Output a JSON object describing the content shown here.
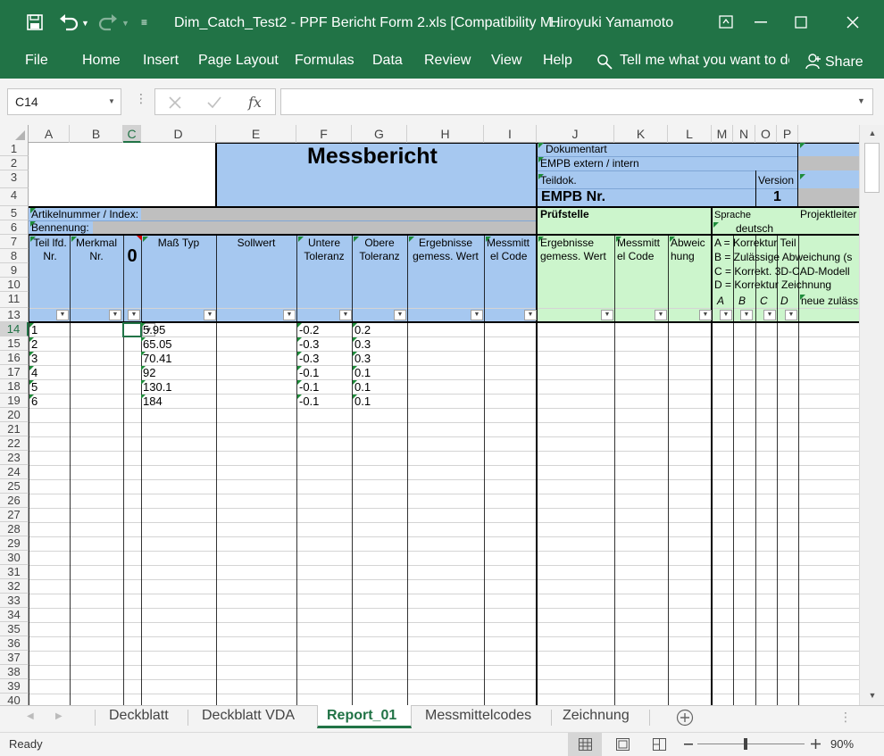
{
  "titlebar": {
    "title": "Dim_Catch_Test2 - PPF Bericht Form 2.xls  [Compatibility M...",
    "user": "Hiroyuki Yamamoto"
  },
  "menu": {
    "file": "File",
    "home": "Home",
    "insert": "Insert",
    "page_layout": "Page Layout",
    "formulas": "Formulas",
    "data": "Data",
    "review": "Review",
    "view": "View",
    "help": "Help",
    "tell_me": "Tell me what you want to do",
    "share": "Share"
  },
  "formula_bar": {
    "name_box": "C14",
    "fx": "fx",
    "content": ""
  },
  "columns": [
    "A",
    "B",
    "C",
    "D",
    "E",
    "F",
    "G",
    "H",
    "I",
    "J",
    "K",
    "L",
    "M",
    "N",
    "O",
    "P"
  ],
  "header": {
    "title": "Messbericht",
    "dokumentart": "Dokumentart",
    "empb_ext": "EMPB extern / intern",
    "teildok": "Teildok.",
    "empb_nr": "EMPB Nr.",
    "version": "Version",
    "version_val": "1",
    "artikel": "Artikelnummer / Index:",
    "benennung": "Bennenung:",
    "pruefstelle": "Prüfstelle",
    "sprache": "Sprache",
    "deutsch": "deutsch",
    "projektleiter": "Projektleiter"
  },
  "col_heads": {
    "teil_1": "Teil lfd.",
    "teil_2": "Nr.",
    "merkmal_1": "Merkmal",
    "merkmal_2": "Nr.",
    "c_glyph": "0",
    "mass": "Maß Typ",
    "sollwert": "Sollwert",
    "untere_1": "Untere",
    "untere_2": "Toleranz",
    "obere_1": "Obere",
    "obere_2": "Toleranz",
    "erg_h_1": "Ergebnisse",
    "erg_h_2": "gemess. Wert",
    "mess_i_1": "Messmitt",
    "mess_i_2": "el Code",
    "erg_j_1": "Ergebnisse",
    "erg_j_2": "gemess. Wert",
    "mess_k_1": "Messmitt",
    "mess_k_2": "el Code",
    "abw_1": "Abweic",
    "abw_2": "hung"
  },
  "legend": {
    "a": "A =  Korrektur Teil",
    "b": "B =  Zulässige Abweichung (s",
    "c": "C =  Korrekt. 3D-CAD-Modell",
    "d": "D =  Korrektur Zeichnung",
    "ca": "A",
    "cb": "B",
    "cc": "C",
    "cd": "D",
    "neue": "neue zuläss"
  },
  "rows": [
    {
      "a": "1",
      "d": "5.95",
      "f": "-0.2",
      "g": "0.2"
    },
    {
      "a": "2",
      "d": "65.05",
      "f": "-0.3",
      "g": "0.3"
    },
    {
      "a": "3",
      "d": "70.41",
      "f": "-0.3",
      "g": "0.3"
    },
    {
      "a": "4",
      "d": "92",
      "f": "-0.1",
      "g": "0.1"
    },
    {
      "a": "5",
      "d": "130.1",
      "f": "-0.1",
      "g": "0.1"
    },
    {
      "a": "6",
      "d": "184",
      "f": "-0.1",
      "g": "0.1"
    }
  ],
  "row_numbers": [
    "1",
    "2",
    "3",
    "4",
    "5",
    "6",
    "7",
    "8",
    "9",
    "10",
    "11",
    "13",
    "14",
    "15",
    "16",
    "17",
    "18",
    "19",
    "20",
    "21",
    "22",
    "23",
    "24",
    "25",
    "26",
    "27",
    "28",
    "29",
    "30",
    "31",
    "32",
    "33",
    "34",
    "35",
    "36",
    "37",
    "38",
    "39",
    "40"
  ],
  "sheet_tabs": [
    "Deckblatt",
    "Deckblatt VDA",
    "Report_01",
    "Messmittelcodes",
    "Zeichnung"
  ],
  "status": {
    "ready": "Ready",
    "zoom": "90%"
  },
  "colors": {
    "excel_green": "#217346",
    "blue_fill": "#a6c8f0",
    "green_fill": "#ccf5cc",
    "gray_fill": "#bfbfbf"
  }
}
